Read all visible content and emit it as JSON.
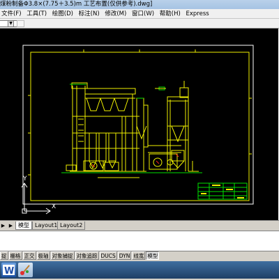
{
  "window": {
    "title": "煤粉制备Φ3.8×(7.75＋3.5)m  工艺布置(仅供参考).dwg]"
  },
  "menu": {
    "items": [
      "文件(F)",
      "工具(T)",
      "绘图(D)",
      "标注(N)",
      "修改(M)",
      "窗口(W)",
      "帮助(H)",
      "Express"
    ]
  },
  "colors": {
    "canvas_bg": "#000000",
    "drawing_yellow": "#f0f000",
    "drawing_green": "#00e000",
    "drawing_red": "#ff2020",
    "frame_white": "#ffffff"
  },
  "layout_tabs": {
    "items": [
      "模型",
      "Layout1",
      "Layout2"
    ],
    "active": "模型"
  },
  "statusbar": {
    "items": [
      "捉",
      "栅格",
      "正交",
      "极轴",
      "对象捕捉",
      "对象追踪",
      "DUCS",
      "DYN",
      "线宽",
      "模型"
    ]
  },
  "taskbar": {
    "icons": [
      "word-icon",
      "paint-icon"
    ]
  },
  "ucs": {
    "x_label": "X",
    "y_label": "Y"
  }
}
